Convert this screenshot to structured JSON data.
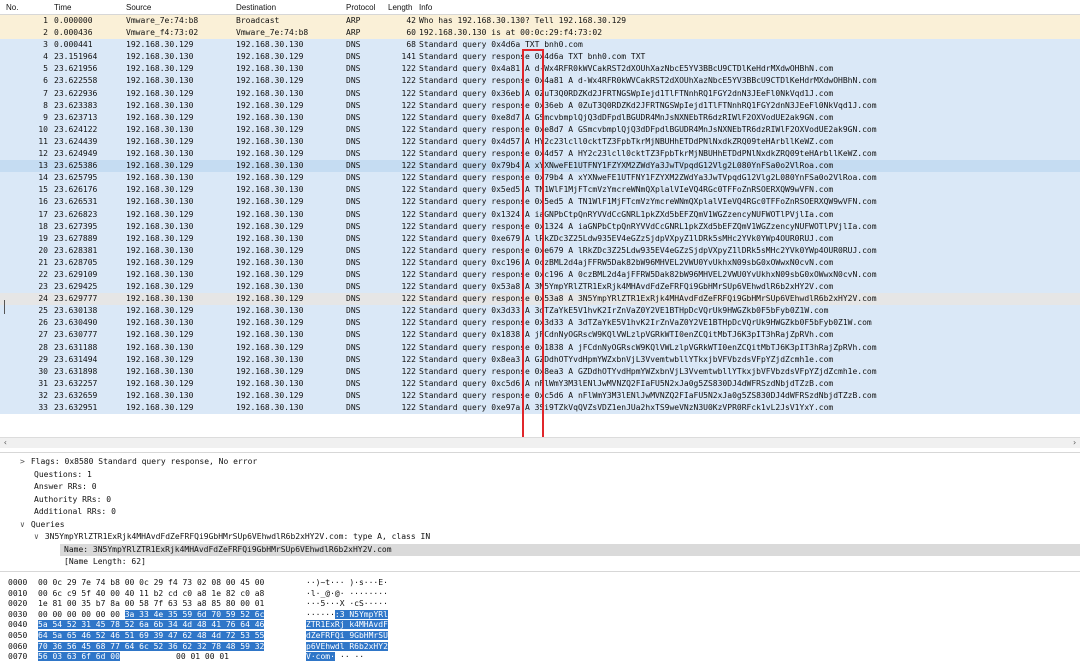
{
  "columns": {
    "no": "No.",
    "time": "Time",
    "source": "Source",
    "destination": "Destination",
    "protocol": "Protocol",
    "length": "Length",
    "info": "Info"
  },
  "packets": [
    {
      "no": "1",
      "time": "0.000000",
      "src": "Vmware_7e:74:b8",
      "dst": "Broadcast",
      "proto": "ARP",
      "len": "42",
      "info": "Who has 192.168.30.130? Tell 192.168.30.129",
      "style": "arp"
    },
    {
      "no": "2",
      "time": "0.000436",
      "src": "Vmware_f4:73:02",
      "dst": "Vmware_7e:74:b8",
      "proto": "ARP",
      "len": "60",
      "info": "192.168.30.130 is at 00:0c:29:f4:73:02",
      "style": "arp"
    },
    {
      "no": "3",
      "time": "0.000441",
      "src": "192.168.30.129",
      "dst": "192.168.30.130",
      "proto": "DNS",
      "len": "68",
      "info": "Standard query 0x4d6a TXT bnh0.com",
      "style": "dns"
    },
    {
      "no": "4",
      "time": "23.151964",
      "src": "192.168.30.130",
      "dst": "192.168.30.129",
      "proto": "DNS",
      "len": "141",
      "info": "Standard query response 0x4d6a TXT bnh0.com TXT",
      "style": "dns"
    },
    {
      "no": "5",
      "time": "23.621956",
      "src": "192.168.30.129",
      "dst": "192.168.30.130",
      "proto": "DNS",
      "len": "122",
      "info": "Standard query 0x4a81 A d-Wx4RFR0kWVCakRST2dXOUhXazNbcE5YV3BBcU9CTDlKeHdrMXdwOHBhN.com",
      "style": "dns"
    },
    {
      "no": "6",
      "time": "23.622558",
      "src": "192.168.30.130",
      "dst": "192.168.30.129",
      "proto": "DNS",
      "len": "122",
      "info": "Standard query response 0x4a81 A d-Wx4RFR0kWVCakRST2dXOUhXazNbcE5YV3BBcU9CTDlKeHdrMXdwOHBhN.com",
      "style": "dns"
    },
    {
      "no": "7",
      "time": "23.622936",
      "src": "192.168.30.129",
      "dst": "192.168.30.130",
      "proto": "DNS",
      "len": "122",
      "info": "Standard query 0x36eb A 0ZuT3Q0RDZKd2JFRTNGSWpIejd1TlFTNnhRQ1FGY2dnN3JEeFl0NkVqd1J.com",
      "style": "dns"
    },
    {
      "no": "8",
      "time": "23.623383",
      "src": "192.168.30.130",
      "dst": "192.168.30.129",
      "proto": "DNS",
      "len": "122",
      "info": "Standard query response 0x36eb A 0ZuT3Q0RDZKd2JFRTNGSWpIejd1TlFTNnhRQ1FGY2dnN3JEeFl0NkVqd1J.com",
      "style": "dns"
    },
    {
      "no": "9",
      "time": "23.623713",
      "src": "192.168.30.129",
      "dst": "192.168.30.130",
      "proto": "DNS",
      "len": "122",
      "info": "Standard query 0xe8d7 A GSmcvbmplQjQ3dDFpdlBGUDR4MnJsNXNEbTR6dzRIWlF2OXVodUE2ak9GN.com",
      "style": "dns"
    },
    {
      "no": "10",
      "time": "23.624122",
      "src": "192.168.30.130",
      "dst": "192.168.30.129",
      "proto": "DNS",
      "len": "122",
      "info": "Standard query response 0xe8d7 A GSmcvbmplQjQ3dDFpdlBGUDR4MnJsNXNEbTR6dzRIWlF2OXVodUE2ak9GN.com",
      "style": "dns"
    },
    {
      "no": "11",
      "time": "23.624439",
      "src": "192.168.30.129",
      "dst": "192.168.30.130",
      "proto": "DNS",
      "len": "122",
      "info": "Standard query 0x4d57 A HY2c23lcll0cktTZ3FpbTkrMjNBUHhETDdPNlNxdkZRQ09teHArbllKeWZ.com",
      "style": "dns"
    },
    {
      "no": "12",
      "time": "23.624949",
      "src": "192.168.30.130",
      "dst": "192.168.30.129",
      "proto": "DNS",
      "len": "122",
      "info": "Standard query response 0x4d57 A HY2c23lcll0cktTZ3FpbTkrMjNBUHhETDdPNlNxdkZRQ09teHArbllKeWZ.com",
      "style": "dns"
    },
    {
      "no": "13",
      "time": "23.625386",
      "src": "192.168.30.129",
      "dst": "192.168.30.130",
      "proto": "DNS",
      "len": "122",
      "info": "Standard query 0x79b4 A xYXNweFE1UTFNY1FZYXM2ZWdYa3JwTVpqdG12Vlg2L080YnFSa0o2VlRoa.com",
      "style": "sel-light"
    },
    {
      "no": "14",
      "time": "23.625795",
      "src": "192.168.30.130",
      "dst": "192.168.30.129",
      "proto": "DNS",
      "len": "122",
      "info": "Standard query response 0x79b4 A xYXNweFE1UTFNY1FZYXM2ZWdYa3JwTVpqdG12Vlg2L080YnFSa0o2VlRoa.com",
      "style": "dns"
    },
    {
      "no": "15",
      "time": "23.626176",
      "src": "192.168.30.129",
      "dst": "192.168.30.130",
      "proto": "DNS",
      "len": "122",
      "info": "Standard query 0x5ed5 A TN1WlF1MjFTcmVzYmcreWNmQXplalVIeVQ4RGc0TFFoZnRSOERXQW9wVFN.com",
      "style": "dns"
    },
    {
      "no": "16",
      "time": "23.626531",
      "src": "192.168.30.130",
      "dst": "192.168.30.129",
      "proto": "DNS",
      "len": "122",
      "info": "Standard query response 0x5ed5 A TN1WlF1MjFTcmVzYmcreWNmQXplalVIeVQ4RGc0TFFoZnRSOERXQW9wVFN.com",
      "style": "dns"
    },
    {
      "no": "17",
      "time": "23.626823",
      "src": "192.168.30.129",
      "dst": "192.168.30.130",
      "proto": "DNS",
      "len": "122",
      "info": "Standard query 0x1324 A iaGNPbCtpQnRYVVdCcGNRL1pkZXd5bEFZQmV1WGZzencyNUFWOTlPVjlIa.com",
      "style": "dns"
    },
    {
      "no": "18",
      "time": "23.627395",
      "src": "192.168.30.130",
      "dst": "192.168.30.129",
      "proto": "DNS",
      "len": "122",
      "info": "Standard query response 0x1324 A iaGNPbCtpQnRYVVdCcGNRL1pkZXd5bEFZQmV1WGZzencyNUFWOTlPVjlIa.com",
      "style": "dns"
    },
    {
      "no": "19",
      "time": "23.627889",
      "src": "192.168.30.129",
      "dst": "192.168.30.130",
      "proto": "DNS",
      "len": "122",
      "info": "Standard query 0xe679 A lRkZDc3Z25Ldw935EV4eGZzSjdpVXpyZ1lDRk5sMHc2YVk0YWp4OUR0RUJ.com",
      "style": "dns"
    },
    {
      "no": "20",
      "time": "23.628381",
      "src": "192.168.30.130",
      "dst": "192.168.30.129",
      "proto": "DNS",
      "len": "122",
      "info": "Standard query response 0xe679 A lRkZDc3Z25Ldw935EV4eGZzSjdpVXpyZ1lDRk5sMHc2YVk0YWp4OUR0RUJ.com",
      "style": "dns"
    },
    {
      "no": "21",
      "time": "23.628705",
      "src": "192.168.30.129",
      "dst": "192.168.30.130",
      "proto": "DNS",
      "len": "122",
      "info": "Standard query 0xc196 A 0czBML2d4ajFFRW5Dak82bW96MHVEL2VWU0YvUkhxN09sbG0xOWwxN0cvN.com",
      "style": "dns"
    },
    {
      "no": "22",
      "time": "23.629109",
      "src": "192.168.30.130",
      "dst": "192.168.30.129",
      "proto": "DNS",
      "len": "122",
      "info": "Standard query response 0xc196 A 0czBML2d4ajFFRW5Dak82bW96MHVEL2VWU0YvUkhxN09sbG0xOWwxN0cvN.com",
      "style": "dns"
    },
    {
      "no": "23",
      "time": "23.629425",
      "src": "192.168.30.129",
      "dst": "192.168.30.130",
      "proto": "DNS",
      "len": "122",
      "info": "Standard query 0x53a8 A 3N5YmpYRlZTR1ExRjk4MHAvdFdZeFRFQi9GbHMrSUp6VEhwdlR6b2xHY2V.com",
      "style": "dns"
    },
    {
      "no": "24",
      "time": "23.629777",
      "src": "192.168.30.130",
      "dst": "192.168.30.129",
      "proto": "DNS",
      "len": "122",
      "info": "Standard query response 0x53a8 A 3N5YmpYRlZTR1ExRjk4MHAvdFdZeFRFQi9GbHMrSUp6VEhwdlR6b2xHY2V.com",
      "style": "cur"
    },
    {
      "no": "25",
      "time": "23.630138",
      "src": "192.168.30.129",
      "dst": "192.168.30.130",
      "proto": "DNS",
      "len": "122",
      "info": "Standard query 0x3d33 A 3dTZaYkE5V1hvK2IrZnVaZ0Y2VE1BTHpDcVQrUk9HWGZkb0F5bFyb0Z1W.com",
      "style": "dns"
    },
    {
      "no": "26",
      "time": "23.630490",
      "src": "192.168.30.130",
      "dst": "192.168.30.129",
      "proto": "DNS",
      "len": "122",
      "info": "Standard query response 0x3d33 A 3dTZaYkE5V1hvK2IrZnVaZ0Y2VE1BTHpDcVQrUk9HWGZkb0F5bFyb0Z1W.com",
      "style": "dns"
    },
    {
      "no": "27",
      "time": "23.630777",
      "src": "192.168.30.129",
      "dst": "192.168.30.130",
      "proto": "DNS",
      "len": "122",
      "info": "Standard query 0x1838 A jFCdnNyOGRscW9KQlVWLzlpVGRkWTI0enZCQitMbTJ6K3pIT3hRajZpRVh.com",
      "style": "dns"
    },
    {
      "no": "28",
      "time": "23.631188",
      "src": "192.168.30.130",
      "dst": "192.168.30.129",
      "proto": "DNS",
      "len": "122",
      "info": "Standard query response 0x1838 A jFCdnNyOGRscW9KQlVWLzlpVGRkWTI0enZCQitMbTJ6K3pIT3hRajZpRVh.com",
      "style": "dns"
    },
    {
      "no": "29",
      "time": "23.631494",
      "src": "192.168.30.129",
      "dst": "192.168.30.130",
      "proto": "DNS",
      "len": "122",
      "info": "Standard query 0x8ea3 A GZDdhOTYvdHpmYWZxbnVjL3VvemtwbllYTkxjbVFVbzdsVFpYZjdZcmh1e.com",
      "style": "dns"
    },
    {
      "no": "30",
      "time": "23.631898",
      "src": "192.168.30.130",
      "dst": "192.168.30.129",
      "proto": "DNS",
      "len": "122",
      "info": "Standard query response 0x8ea3 A GZDdhOTYvdHpmYWZxbnVjL3VvemtwbllYTkxjbVFVbzdsVFpYZjdZcmh1e.com",
      "style": "dns"
    },
    {
      "no": "31",
      "time": "23.632257",
      "src": "192.168.30.129",
      "dst": "192.168.30.130",
      "proto": "DNS",
      "len": "122",
      "info": "Standard query 0xc5d6 A nFlWmY3M3lENlJwMVNZQ2FIaFU5N2xJa0g5ZS830DJ4dWFRSzdNbjdTZzB.com",
      "style": "dns"
    },
    {
      "no": "32",
      "time": "23.632659",
      "src": "192.168.30.130",
      "dst": "192.168.30.129",
      "proto": "DNS",
      "len": "122",
      "info": "Standard query response 0xc5d6 A nFlWmY3M3lENlJwMVNZQ2FIaFU5N2xJa0g5ZS830DJ4dWFRSzdNbjdTZzB.com",
      "style": "dns"
    },
    {
      "no": "33",
      "time": "23.632951",
      "src": "192.168.30.129",
      "dst": "192.168.30.130",
      "proto": "DNS",
      "len": "122",
      "info": "Standard query 0xe97a A 3Si9TZkVqQVZsVDZ1enJUa2hxTS9weVNzN3U0KzVPR0RFck1vL2JsV1YxY.com",
      "style": "dns"
    }
  ],
  "details": {
    "flags": "Flags: 0x8580 Standard query response, No error",
    "questions": "Questions: 1",
    "answer_rrs": "Answer RRs: 0",
    "authority_rrs": "Authority RRs: 0",
    "additional_rrs": "Additional RRs: 0",
    "queries": "Queries",
    "query_entry": "3N5YmpYRlZTR1ExRjk4MHAvdFdZeFRFQi9GbHMrSUp6VEhwdlR6b2xHY2V.com: type A, class IN",
    "name": "Name: 3N5YmpYRlZTR1ExRjk4MHAvdFdZeFRFQi9GbHMrSUp6VEhwdlR6b2xHY2V.com",
    "name_length": "[Name Length: 62]"
  },
  "hex": [
    {
      "off": "0000",
      "bytes": "00 0c 29 7e 74 b8 00 0c  29 f4 73 02 08 00 45 00",
      "sel_bytes": "",
      "asc": "··)~t···  )·s···E·",
      "sel_asc": ""
    },
    {
      "off": "0010",
      "bytes": "00 6c c9 5f 40 00 40 11  b2 cd c0 a8 1e 82 c0 a8",
      "sel_bytes": "",
      "asc": "·l·_@·@·  ········",
      "sel_asc": ""
    },
    {
      "off": "0020",
      "bytes": "1e 81 00 35 b7 8a 00 58  7f 63 53 a8 85 80 00 01",
      "sel_bytes": "",
      "asc": "···5···X  ·cS·····",
      "sel_asc": ""
    },
    {
      "off": "0030",
      "bytes": "00 00 00 00 00 00 ",
      "sel_bytes": "3a 33  4e 35 59 6d 70 59 52 6c",
      "asc": "······",
      "sel_asc": ":3 N5YmpYRl"
    },
    {
      "off": "0040",
      "bytes": "",
      "sel_bytes": "5a 54 52 31 45 78 52 6a  6b 34 4d 48 41 76 64 46",
      "asc": "",
      "sel_asc": "ZTR1ExRj  k4MHAvdF"
    },
    {
      "off": "0050",
      "bytes": "",
      "sel_bytes": "64 5a 65 46 52 46 51 69  39 47 62 48 4d 72 53 55",
      "asc": "",
      "sel_asc": "dZeFRFQi  9GbHMrSU"
    },
    {
      "off": "0060",
      "bytes": "",
      "sel_bytes": "70 36 56 45 68 77 64 6c  52 36 62 32 78 48 59 32",
      "asc": "",
      "sel_asc": "p6VEhwdl  R6b2xHY2"
    },
    {
      "off": "0070",
      "bytes": "",
      "sel_bytes": "56 03 63 6f 6d 00",
      "asc": "",
      "sel_asc": "V·com·"
    },
    {
      "off": "",
      "bytes": " 00 01  00 01",
      "sel_bytes": "",
      "asc": "··  ··",
      "sel_asc": ""
    }
  ],
  "colors": {
    "arp_row": "#faf0d7",
    "dns_row": "#dae8f7",
    "current_row": "#e6e6e6",
    "hex_selection": "#2f76c8",
    "highlight_box": "#e0262b"
  }
}
